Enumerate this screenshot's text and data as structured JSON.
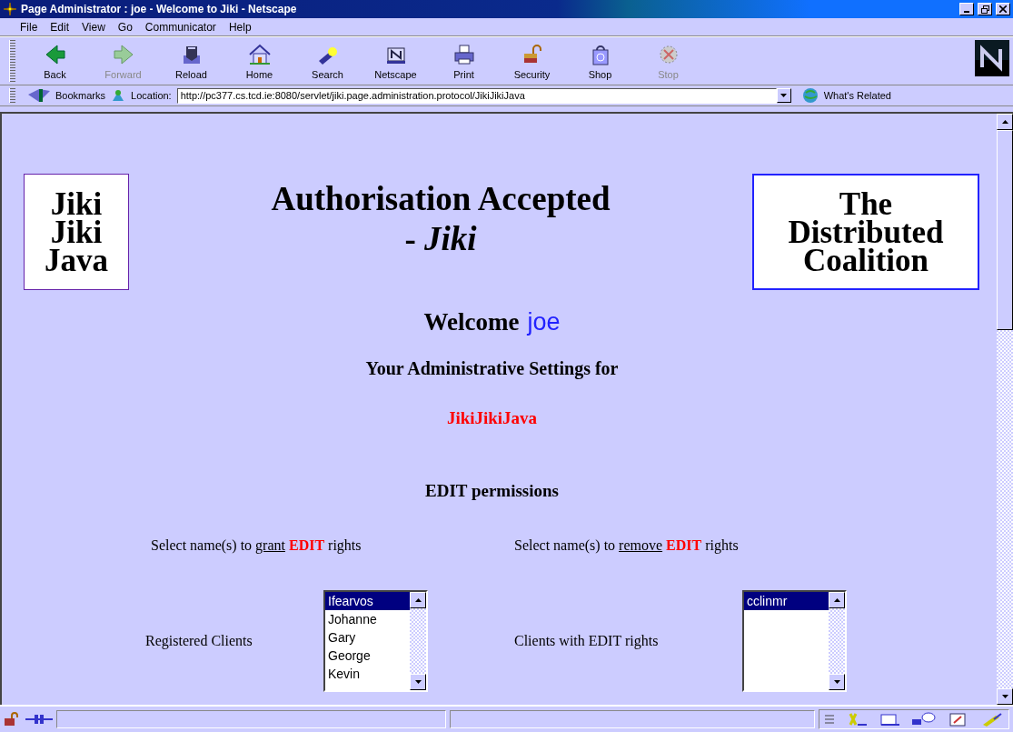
{
  "window": {
    "title": "Page Administrator : joe - Welcome to Jiki - Netscape"
  },
  "menu": [
    "File",
    "Edit",
    "View",
    "Go",
    "Communicator",
    "Help"
  ],
  "toolbar": [
    {
      "label": "Back",
      "kind": "back",
      "disabled": false
    },
    {
      "label": "Forward",
      "kind": "forward",
      "disabled": true
    },
    {
      "label": "Reload",
      "kind": "reload",
      "disabled": false
    },
    {
      "label": "Home",
      "kind": "home",
      "disabled": false
    },
    {
      "label": "Search",
      "kind": "search",
      "disabled": false
    },
    {
      "label": "Netscape",
      "kind": "netscape",
      "disabled": false
    },
    {
      "label": "Print",
      "kind": "print",
      "disabled": false
    },
    {
      "label": "Security",
      "kind": "security",
      "disabled": false
    },
    {
      "label": "Shop",
      "kind": "shop",
      "disabled": false
    },
    {
      "label": "Stop",
      "kind": "stop",
      "disabled": true
    }
  ],
  "location_bar": {
    "bookmarks": "Bookmarks",
    "label": "Location:",
    "url": "http://pc377.cs.tcd.ie:8080/servlet/jiki.page.administration.protocol/JikiJikiJava",
    "related": "What's Related"
  },
  "page": {
    "logo_left": [
      "Jiki",
      "Jiki",
      "Java"
    ],
    "logo_right": [
      "The",
      "Distributed",
      "Coalition"
    ],
    "heading": "Authorisation Accepted",
    "subheading": "- *Jiki*",
    "welcome": "Welcome",
    "user": "joe",
    "settings_heading": "Your Administrative Settings for",
    "page_name": "JikiJikiJava",
    "section_title": "EDIT permissions",
    "panels": [
      {
        "prefix": "Select name(s) to",
        "action": "grant",
        "keyword": "EDIT",
        "suffix": "rights",
        "list_label": "Registered Clients",
        "items": [
          {
            "name": "Ifearvos",
            "selected": true
          },
          {
            "name": "Johanne",
            "selected": false
          },
          {
            "name": "Gary",
            "selected": false
          },
          {
            "name": "George",
            "selected": false
          },
          {
            "name": "Kevin",
            "selected": false
          }
        ]
      },
      {
        "prefix": "Select name(s) to",
        "action": "remove",
        "keyword": "EDIT",
        "suffix": "rights",
        "list_label": "Clients with EDIT rights",
        "items": [
          {
            "name": "cclinmr",
            "selected": true
          }
        ]
      }
    ]
  }
}
